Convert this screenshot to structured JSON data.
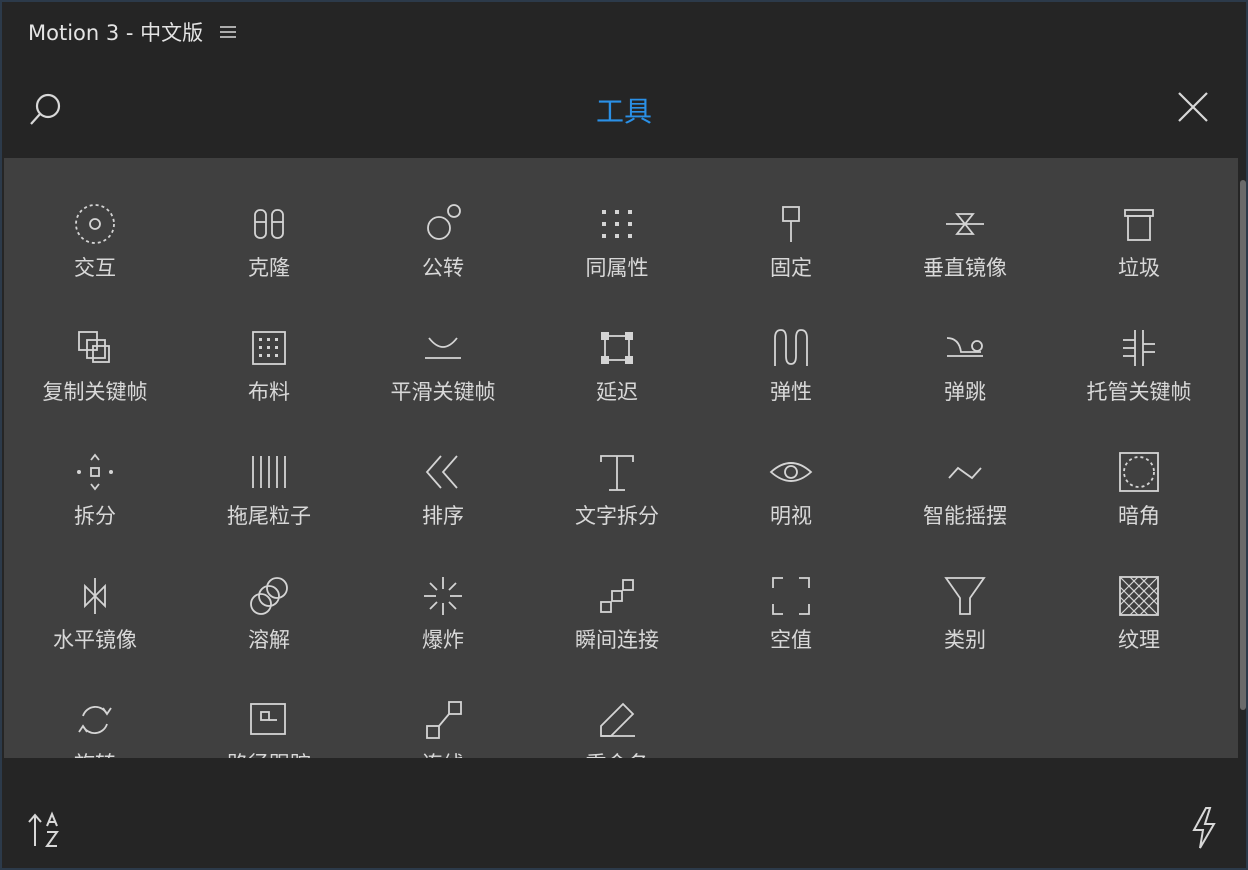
{
  "window": {
    "title": "Motion 3 - 中文版"
  },
  "header": {
    "title": "工具"
  },
  "tools": [
    {
      "label": "交互",
      "icon": "interaction-icon"
    },
    {
      "label": "克隆",
      "icon": "clone-icon"
    },
    {
      "label": "公转",
      "icon": "orbit-icon"
    },
    {
      "label": "同属性",
      "icon": "same-property-icon"
    },
    {
      "label": "固定",
      "icon": "pin-icon"
    },
    {
      "label": "垂直镜像",
      "icon": "vertical-mirror-icon"
    },
    {
      "label": "垃圾",
      "icon": "trash-icon"
    },
    {
      "label": "复制关键帧",
      "icon": "copy-keyframe-icon"
    },
    {
      "label": "布料",
      "icon": "cloth-icon"
    },
    {
      "label": "平滑关键帧",
      "icon": "smooth-keyframe-icon"
    },
    {
      "label": "延迟",
      "icon": "delay-icon"
    },
    {
      "label": "弹性",
      "icon": "elastic-icon"
    },
    {
      "label": "弹跳",
      "icon": "bounce-icon"
    },
    {
      "label": "托管关键帧",
      "icon": "managed-keyframe-icon"
    },
    {
      "label": "拆分",
      "icon": "split-icon"
    },
    {
      "label": "拖尾粒子",
      "icon": "trail-particle-icon"
    },
    {
      "label": "排序",
      "icon": "sort-order-icon"
    },
    {
      "label": "文字拆分",
      "icon": "text-split-icon"
    },
    {
      "label": "明视",
      "icon": "eye-icon"
    },
    {
      "label": "智能摇摆",
      "icon": "wiggle-icon"
    },
    {
      "label": "暗角",
      "icon": "vignette-icon"
    },
    {
      "label": "水平镜像",
      "icon": "horizontal-mirror-icon"
    },
    {
      "label": "溶解",
      "icon": "dissolve-icon"
    },
    {
      "label": "爆炸",
      "icon": "explode-icon"
    },
    {
      "label": "瞬间连接",
      "icon": "instant-connect-icon"
    },
    {
      "label": "空值",
      "icon": "null-icon"
    },
    {
      "label": "类别",
      "icon": "filter-icon"
    },
    {
      "label": "纹理",
      "icon": "texture-icon"
    },
    {
      "label": "旋转",
      "icon": "rotate-icon"
    },
    {
      "label": "路径跟踪",
      "icon": "path-follow-icon"
    },
    {
      "label": "连线",
      "icon": "connect-line-icon"
    },
    {
      "label": "重命名",
      "icon": "rename-icon"
    }
  ],
  "colors": {
    "accent": "#2a90e6",
    "panel": "#404040",
    "chrome": "#252525"
  }
}
